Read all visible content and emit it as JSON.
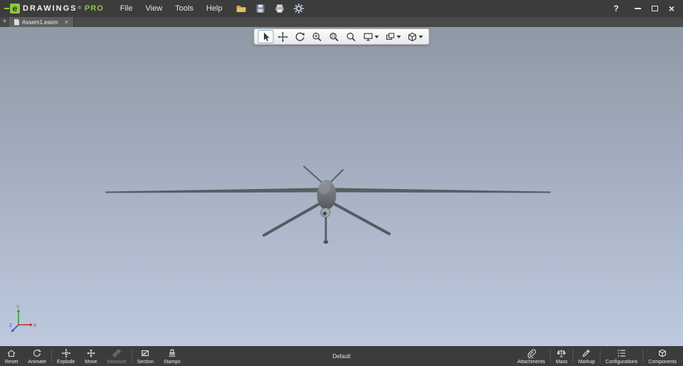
{
  "titlebar": {
    "logo": {
      "e": "e",
      "name": "DRAWINGS",
      "trademark": "®",
      "edition": "PRO"
    },
    "menus": [
      "File",
      "View",
      "Tools",
      "Help"
    ],
    "tool_icons": [
      "open",
      "save",
      "print",
      "options"
    ],
    "window_controls": {
      "help": "?",
      "close": "×"
    }
  },
  "tabbar": {
    "new_tab": "+",
    "active_tab": {
      "label": "Assem1.easm",
      "close": "×"
    }
  },
  "viewport": {
    "toolbar": {
      "active_tool": "select",
      "tools": [
        "select",
        "pan",
        "rotate",
        "zoom-to-fit",
        "zoom-area",
        "zoom",
        "display-mode",
        "view-orientation",
        "model-views"
      ]
    },
    "model": "uav-drone-front-view",
    "triad_axes": {
      "x": "X",
      "y": "Y",
      "z": "Z"
    }
  },
  "statusbar": {
    "left": [
      {
        "label": "Reset",
        "icon": "home"
      },
      {
        "label": "Animate",
        "icon": "animate"
      },
      {
        "label": "Explode",
        "icon": "explode"
      },
      {
        "label": "Move",
        "icon": "move"
      },
      {
        "label": "Measure",
        "icon": "measure",
        "disabled": true
      },
      {
        "label": "Section",
        "icon": "section"
      },
      {
        "label": "Stamps",
        "icon": "stamp"
      }
    ],
    "configuration": "Default",
    "right": [
      {
        "label": "Attachments",
        "icon": "paperclip"
      },
      {
        "label": "Mass",
        "icon": "scale"
      },
      {
        "label": "Markup",
        "icon": "pencil"
      },
      {
        "label": "Configurations",
        "icon": "list"
      },
      {
        "label": "Components",
        "icon": "cube"
      }
    ]
  },
  "colors": {
    "accent_green": "#8dc63f",
    "chrome": "#3c3c3c",
    "viewport_top": "#8f99a5",
    "viewport_bottom": "#bdc9dd"
  }
}
